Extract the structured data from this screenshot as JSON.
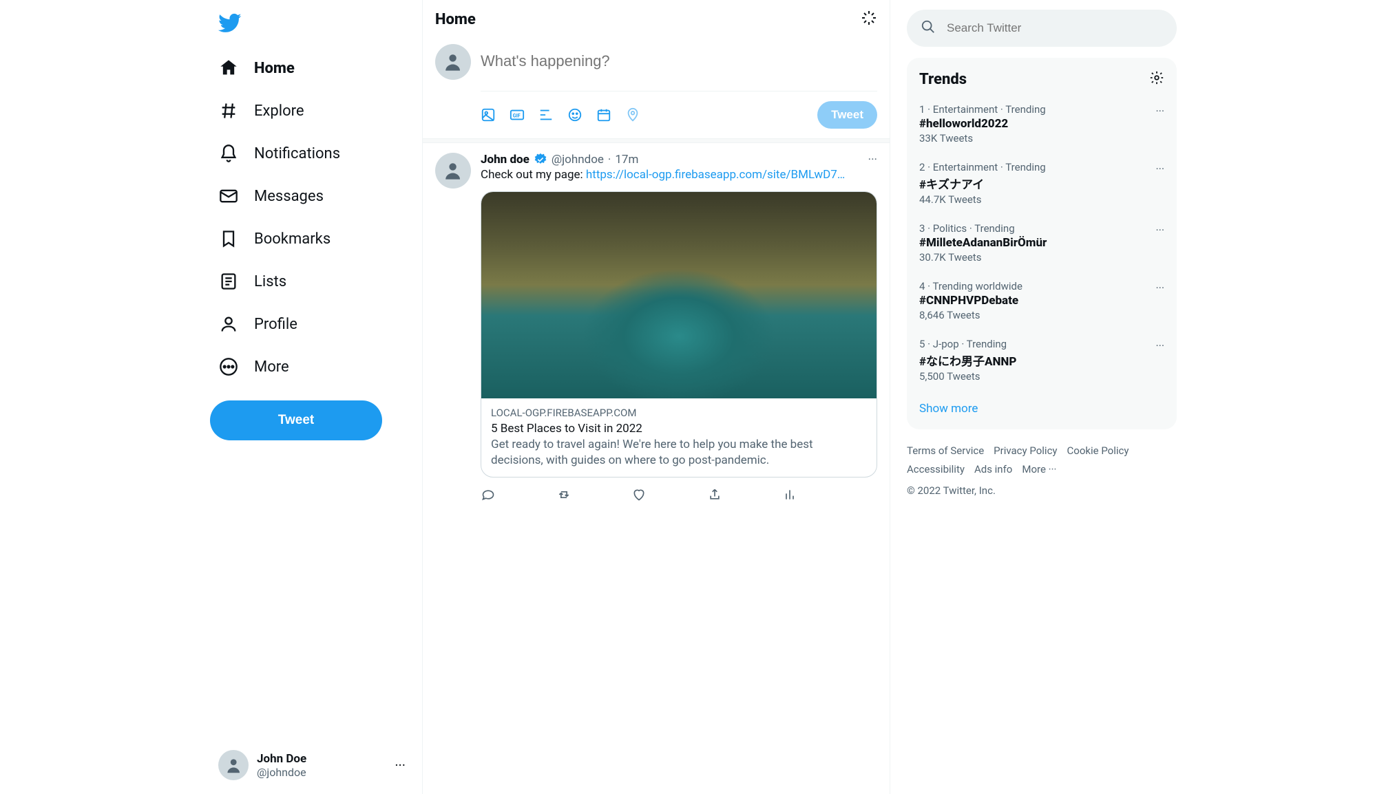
{
  "nav": {
    "items": [
      {
        "label": "Home",
        "active": true
      },
      {
        "label": "Explore"
      },
      {
        "label": "Notifications"
      },
      {
        "label": "Messages"
      },
      {
        "label": "Bookmarks"
      },
      {
        "label": "Lists"
      },
      {
        "label": "Profile"
      },
      {
        "label": "More"
      }
    ],
    "tweet_button": "Tweet"
  },
  "account": {
    "display_name": "John Doe",
    "handle": "@johndoe"
  },
  "header": {
    "title": "Home"
  },
  "composer": {
    "placeholder": "What's happening?",
    "tweet_button": "Tweet"
  },
  "feed": {
    "tweet": {
      "author": "John doe",
      "handle": "@johndoe",
      "time_sep": " · ",
      "time": "17m",
      "text_prefix": "Check out my page: ",
      "link_text": "https://local-ogp.firebaseapp.com/site/BMLwD7…",
      "card": {
        "domain": "LOCAL-OGP.FIREBASEAPP.COM",
        "title": "5 Best Places to Visit in 2022",
        "description": "Get ready to travel again! We're here to help you make the best decisions, with guides on where to go post-pandemic."
      }
    }
  },
  "search": {
    "placeholder": "Search Twitter"
  },
  "trends": {
    "title": "Trends",
    "show_more": "Show more",
    "items": [
      {
        "meta": "1 · Entertainment · Trending",
        "tag": "#helloworld2022",
        "count": "33K Tweets"
      },
      {
        "meta": "2 · Entertainment · Trending",
        "tag": "#キズナアイ",
        "count": "44.7K Tweets"
      },
      {
        "meta": "3 · Politics · Trending",
        "tag": "#MilleteAdananBirÖmür",
        "count": "30.7K Tweets"
      },
      {
        "meta": "4 · Trending worldwide",
        "tag": "#CNNPHVPDebate",
        "count": "8,646 Tweets"
      },
      {
        "meta": "5 · J-pop · Trending",
        "tag": "#なにわ男子ANNP",
        "count": "5,500 Tweets"
      }
    ]
  },
  "footer": {
    "links": [
      "Terms of Service",
      "Privacy Policy",
      "Cookie Policy",
      "Accessibility",
      "Ads info",
      "More ···"
    ],
    "copyright": "© 2022 Twitter, Inc."
  }
}
